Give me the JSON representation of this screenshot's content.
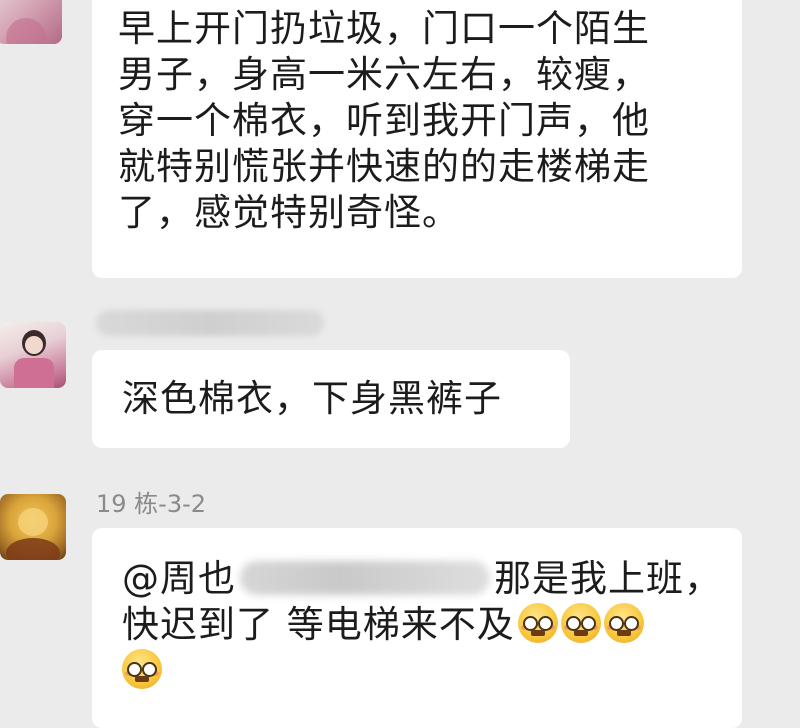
{
  "chat": {
    "messages": [
      {
        "lines": [
          "早上开门扔垃圾，门口一个陌生",
          "男子，身高一米六左右，较瘦，",
          "穿一个棉衣，听到我开门声，他",
          "就特别慌张并快速的的走楼梯走",
          "了，感觉特别奇怪。"
        ]
      },
      {
        "lines": [
          "深色棉衣，下身黑裤子"
        ]
      },
      {
        "sender": "19 栋-3-2",
        "mention": "@周也",
        "line1_rest": "那是我上班，",
        "line2": "快迟到了 等电梯来不及"
      }
    ]
  },
  "icons": {
    "emoji": "grimacing-nerd-face-emoji"
  }
}
